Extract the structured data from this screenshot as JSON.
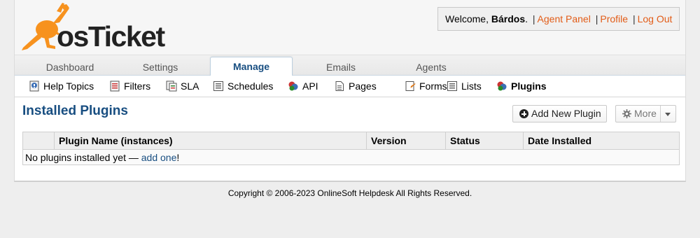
{
  "brand": {
    "logo_text": "osTicket"
  },
  "header": {
    "welcome_prefix": "Welcome, ",
    "user_name": "Bárdos",
    "welcome_suffix": ".",
    "separator": "|",
    "links": [
      "Agent Panel",
      "Profile",
      "Log Out"
    ]
  },
  "tabs": [
    {
      "label": "Dashboard",
      "active": false
    },
    {
      "label": "Settings",
      "active": false
    },
    {
      "label": "Manage",
      "active": true
    },
    {
      "label": "Emails",
      "active": false
    },
    {
      "label": "Agents",
      "active": false
    }
  ],
  "subnav": [
    {
      "label": "Help Topics",
      "icon": "help-topics-icon"
    },
    {
      "label": "Filters",
      "icon": "filters-icon"
    },
    {
      "label": "SLA",
      "icon": "sla-icon"
    },
    {
      "label": "Schedules",
      "icon": "schedules-icon"
    },
    {
      "label": "API",
      "icon": "api-icon"
    },
    {
      "label": "Pages",
      "icon": "pages-icon"
    },
    {
      "label": "Forms",
      "icon": "forms-icon"
    },
    {
      "label": "Lists",
      "icon": "lists-icon"
    },
    {
      "label": "Plugins",
      "icon": "plugins-icon",
      "active": true
    }
  ],
  "main": {
    "title": "Installed Plugins",
    "add_button": "Add New Plugin",
    "more_button": "More",
    "table": {
      "columns": [
        "",
        "Plugin Name (instances)",
        "Version",
        "Status",
        "Date Installed"
      ],
      "empty_prefix": "No plugins installed yet — ",
      "empty_link": "add one",
      "empty_suffix": "!"
    }
  },
  "footer": {
    "copyright": "Copyright © 2006-2023 OnlineSoft Helpdesk All Rights Reserved."
  },
  "colors": {
    "accent_blue": "#184e81",
    "link_orange": "#e25c17",
    "logo_orange": "#f7921e"
  }
}
